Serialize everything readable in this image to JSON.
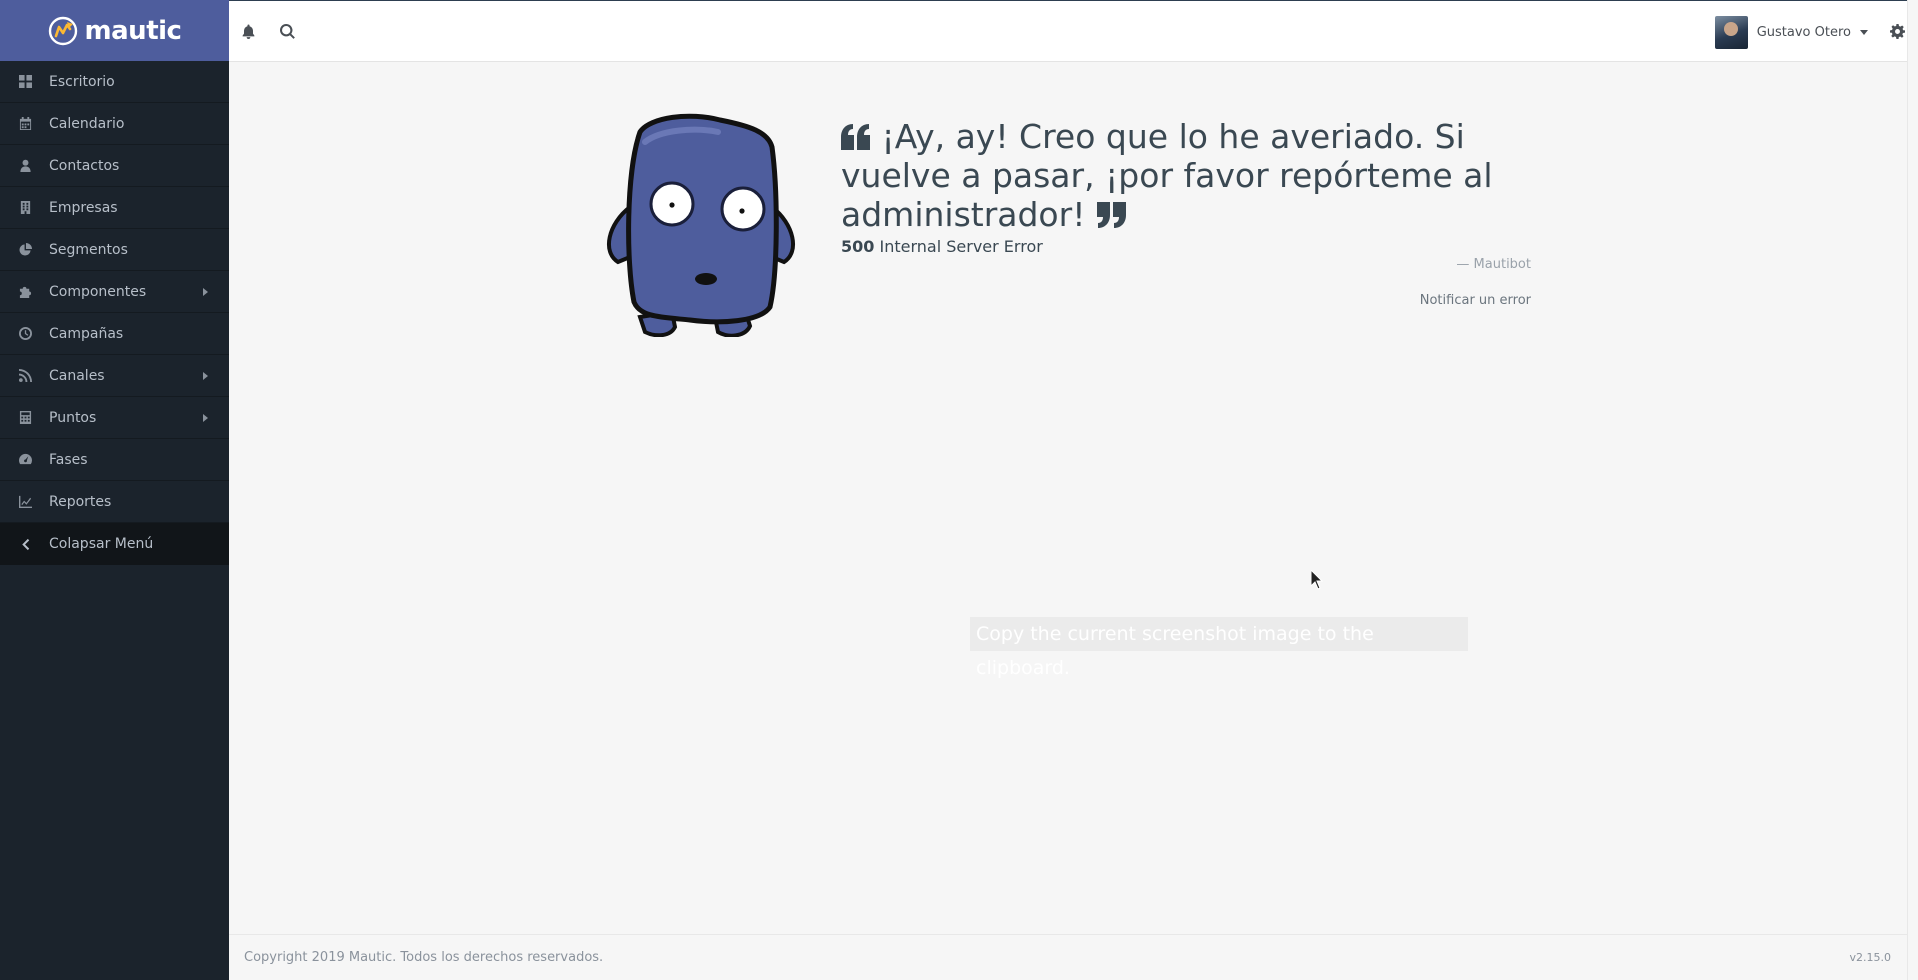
{
  "brand": {
    "name": "mautic"
  },
  "sidebar": {
    "items": [
      {
        "label": "Escritorio",
        "icon": "grid-icon",
        "has_submenu": false
      },
      {
        "label": "Calendario",
        "icon": "calendar-icon",
        "has_submenu": false
      },
      {
        "label": "Contactos",
        "icon": "user-icon",
        "has_submenu": false
      },
      {
        "label": "Empresas",
        "icon": "building-icon",
        "has_submenu": false
      },
      {
        "label": "Segmentos",
        "icon": "pie-chart-icon",
        "has_submenu": false
      },
      {
        "label": "Componentes",
        "icon": "puzzle-icon",
        "has_submenu": true
      },
      {
        "label": "Campañas",
        "icon": "clock-icon",
        "has_submenu": false
      },
      {
        "label": "Canales",
        "icon": "rss-icon",
        "has_submenu": true
      },
      {
        "label": "Puntos",
        "icon": "calculator-icon",
        "has_submenu": true
      },
      {
        "label": "Fases",
        "icon": "tachometer-icon",
        "has_submenu": false
      },
      {
        "label": "Reportes",
        "icon": "line-chart-icon",
        "has_submenu": false
      }
    ],
    "collapse_label": "Colapsar Menú"
  },
  "topbar": {
    "user_name": "Gustavo Otero"
  },
  "error": {
    "message": "¡Ay, ay! Creo que lo he averiado. Si vuelve a pasar, ¡por favor repórteme al administrador!",
    "code": "500",
    "status_text": "Internal Server Error",
    "signature": "— Mautibot",
    "report_link": "Notificar un error"
  },
  "tooltip": {
    "text": "Copy the current screenshot image to the clipboard."
  },
  "footer": {
    "copyright": "Copyright 2019 Mautic. Todos los derechos reservados.",
    "version": "v2.15.0"
  },
  "colors": {
    "sidebar_bg": "#1b232c",
    "brand_bg": "#4e5d9d",
    "accent_orange": "#fdb933",
    "text_dark": "#3a4852",
    "mascot_body": "#4e5d9d"
  }
}
